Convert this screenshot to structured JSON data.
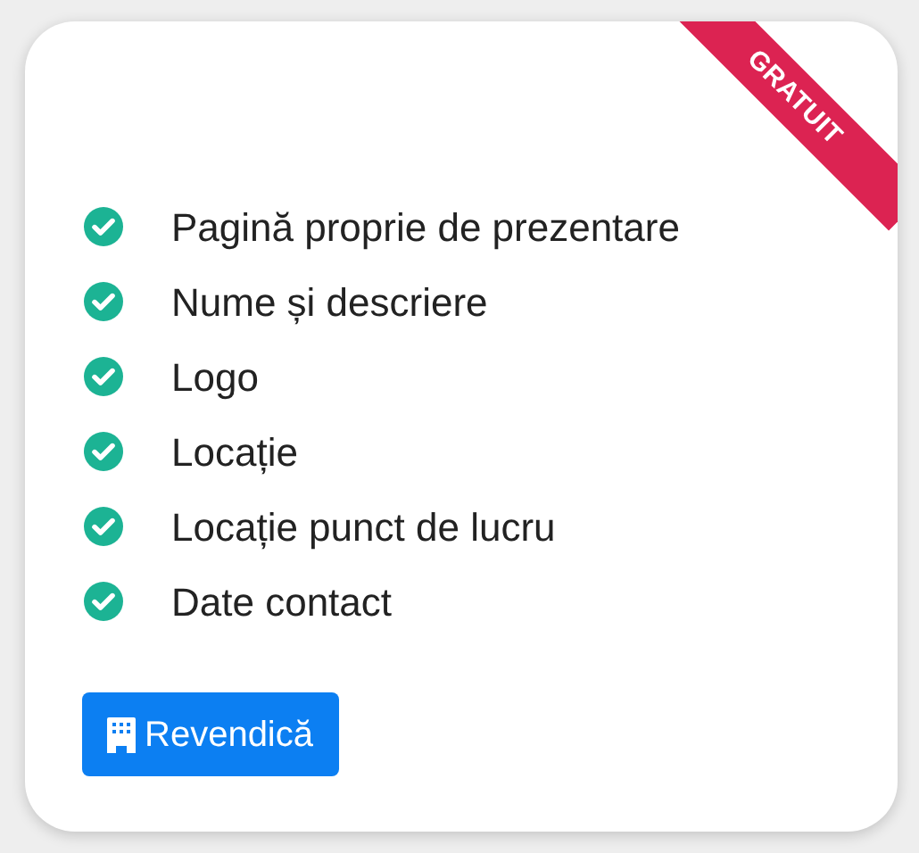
{
  "ribbon": {
    "label": "GRATUIT"
  },
  "features": [
    {
      "label": "Pagină proprie de prezentare",
      "included": true
    },
    {
      "label": "Nume și descriere",
      "included": true
    },
    {
      "label": "Logo",
      "included": true
    },
    {
      "label": "Locație",
      "included": true
    },
    {
      "label": "Locație punct de lucru",
      "included": true
    },
    {
      "label": "Date contact",
      "included": true
    }
  ],
  "button": {
    "label": "Revendică"
  }
}
